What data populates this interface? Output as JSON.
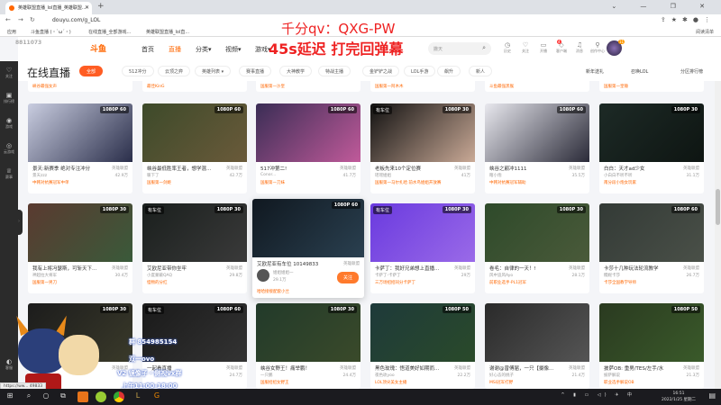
{
  "browser": {
    "tab_title": "英雄联盟直播_lol直播_英雄联盟...",
    "url": "douyu.com/g_LOL",
    "bookmarks": [
      "应用",
      "斗鱼直播 (・`ω´・)",
      "在线直播_全部游戏...",
      "英雄联盟直播_lol直..."
    ],
    "reading_list": "阅读清单",
    "new_tab": "+",
    "win_controls": "⌄ — ❐ ✕"
  },
  "overlay": {
    "line1": "千分qv：QXG-PW",
    "line2": "45s延迟 打完回弹幕",
    "watermark": "8811073",
    "group": "群 854985154",
    "name": "双一ovo",
    "vx": "V2 镜像子 · 侧视vx群",
    "hours": "上午11:00-18:00"
  },
  "header": {
    "logo": "斗鱼",
    "nav": [
      "首页",
      "直播",
      "分类▾",
      "视频▾",
      "游戏▾"
    ],
    "search_placeholder": "撒天",
    "icons": [
      {
        "icon": "history-icon",
        "label": "历史",
        "g": "◷"
      },
      {
        "icon": "heart-icon",
        "label": "关注",
        "g": "♡"
      },
      {
        "icon": "camera-icon",
        "label": "开播",
        "g": "▭"
      },
      {
        "icon": "client-icon",
        "label": "客户端",
        "g": "◇"
      },
      {
        "icon": "bell-icon",
        "label": "消息",
        "g": "♫"
      },
      {
        "icon": "creator-icon",
        "label": "创作中心",
        "g": "⚲"
      }
    ],
    "client_badge": "4",
    "avatar_badge": "11"
  },
  "filter": {
    "title": "在线直播",
    "pills": [
      "全部",
      "512冲分",
      "云顶之弈",
      "英雄列表 ▾",
      "赛事直播",
      "大神教学",
      "特战主播",
      "金铲铲之战",
      "LOL手游",
      "飙升",
      "新人"
    ],
    "right": [
      "新年送礼",
      "召唤LOL",
      "分区排行榜"
    ]
  },
  "sidebar": [
    {
      "label": "关注",
      "g": "♡"
    },
    {
      "label": "排行榜",
      "g": "▣"
    },
    {
      "label": "游戏",
      "g": "◉"
    },
    {
      "label": "云游戏",
      "g": "◎"
    },
    {
      "label": "赛事",
      "g": "♕"
    }
  ],
  "sidebar_bottom": {
    "label": "客服",
    "g": "◐"
  },
  "top_tags": [
    "峡谷最强女声",
    "最佳KinG",
    "国服第一沙皇",
    "国服第一阿木木",
    "斗鱼最强黑猴",
    "国服第一皇锤"
  ],
  "category": "英雄联盟",
  "cards": [
    {
      "title": "景天:新赛季 绝对专注冲分",
      "streamer": "景天zzz",
      "heat": "42.9万",
      "tag": "中韩对抗赛冠军中单",
      "res": "1080P 60",
      "car": "",
      "c1": "#c9cde0",
      "c2": "#2a2e4a"
    },
    {
      "title": "峡谷最低胜率王者，想学混...",
      "streamer": "暖下了",
      "heat": "42.7万",
      "tag": "国服第一剑姬",
      "res": "1080P 60",
      "car": "",
      "c1": "#3d4a2a",
      "c2": "#6a5a3a"
    },
    {
      "title": "517冲第二!",
      "streamer": "Conor...",
      "heat": "41.7万",
      "tag": "国服第一刀妹",
      "res": "1080P 60",
      "car": "",
      "c1": "#3a2d55",
      "c2": "#c05a9a"
    },
    {
      "title": "老板先来10个定位赛",
      "streamer": "瑶瑶姐姐",
      "heat": "41万",
      "tag": "国服第一马尔扎哈 前水鸟姐姐开放赛",
      "res": "1080P 30",
      "car": "有车位",
      "c1": "#111",
      "c2": "#c9a996"
    },
    {
      "title": "峡谷之巅冲1111",
      "streamer": "瞎小炮",
      "heat": "35.5万",
      "tag": "中韩对抗赛冠军辅助",
      "res": "1080P 60",
      "car": "",
      "c1": "#e8e8ee",
      "c2": "#2a2a38"
    },
    {
      "title": "白白：天才ad少女",
      "streamer": "小白白不听不听",
      "heat": "31.1万",
      "tag": "南分段小炮女玩家",
      "res": "1080P 30",
      "car": "",
      "c1": "#1d2a26",
      "c2": "#0e1512"
    },
    {
      "title": "我有上将冯瑟斯，可斩天下...",
      "streamer": "神超拉大将军",
      "heat": "30.4万",
      "tag": "国服第一男刀",
      "res": "1080P 30",
      "car": "",
      "c1": "#5a3a30",
      "c2": "#3a5a3a"
    },
    {
      "title": "艾欧尼亚带你坐牢",
      "streamer": "小度蒙蔽QAQ",
      "heat": "29.8万",
      "tag": "怪物的分红",
      "res": "1080P 30",
      "car": "有车位",
      "c1": "#1a1f1d",
      "c2": "#3a3a3a"
    },
    {
      "title": "艾欧尼亚有车位 10149833",
      "streamer": "姐姐姐姐一",
      "heat": "29.1万",
      "tag": "哈哈接接配套小兰",
      "res": "1080P 60",
      "car": "",
      "c1": "#101820",
      "c2": "#2a4050",
      "hover": true,
      "follow": "关注"
    },
    {
      "title": "卡萨丁：我好兄弟想上直播...",
      "streamer": "卡萨丁-卡萨丁",
      "heat": "29万",
      "tag": "三万场招招同分卡萨丁",
      "res": "1080P 30",
      "car": "有车位",
      "c1": "#6a3adf",
      "c2": "#9a6ae8"
    },
    {
      "title": "卷毛：自律的一天！!",
      "streamer": "风中追风Ayo",
      "heat": "28.1万",
      "tag": "前职业选手·PL1冠军",
      "res": "1080P 30",
      "car": "",
      "c1": "#2e4a2a",
      "c2": "#4a5a3a"
    },
    {
      "title": "卡莎十几种玩法轮流教学",
      "streamer": "糯妮卡莎",
      "heat": "26.7万",
      "tag": "卡莎全国教学导师",
      "res": "1080P 60",
      "car": "",
      "c1": "#333a36",
      "c2": "#4a5048"
    },
    {
      "title": "...恋爱~",
      "streamer": "",
      "heat": "",
      "tag": "",
      "res": "1080P 30",
      "car": "",
      "c1": "#1c1c1c",
      "c2": "#3a3a2a"
    },
    {
      "title": "一起看直播",
      "streamer": "",
      "heat": "24.7万",
      "tag": "",
      "res": "1080P 60",
      "car": "有车位",
      "c1": "#1a1a1a",
      "c2": "#333"
    },
    {
      "title": "峡谷女野王！痛举鹏！",
      "streamer": "一只鹏",
      "heat": "24.4万",
      "tag": "国服招招女野王",
      "res": "1080P 30",
      "car": "",
      "c1": "#223a2a",
      "c2": "#3a4a2a"
    },
    {
      "title": "黑色玫瑰：悟道美好如期而...",
      "streamer": "夜色玫yoo",
      "heat": "22.2万",
      "tag": "LOL顶尖美女主播",
      "res": "1080P 50",
      "car": "",
      "c1": "#1e3a3a",
      "c2": "#2a4a2a"
    },
    {
      "title": "谢谢@曾傅届，一只【摄像...",
      "streamer": "好心态的桃子",
      "heat": "21.4万",
      "tag": "MSI冠军打野",
      "res": "",
      "car": "",
      "c1": "#2a2a2a",
      "c2": "#555"
    },
    {
      "title": "披萨OB: 重男/TES/左手/水",
      "streamer": "披萨解说",
      "heat": "21.3万",
      "tag": "职业选手解说OB",
      "res": "1080P 50",
      "car": "",
      "c1": "#2a3a20",
      "c2": "#3a5a2a"
    }
  ],
  "status_url": "https://ww...  49833",
  "taskbar": {
    "time": "16:51",
    "date": "2022/1/25 星期二",
    "ime": "中"
  }
}
